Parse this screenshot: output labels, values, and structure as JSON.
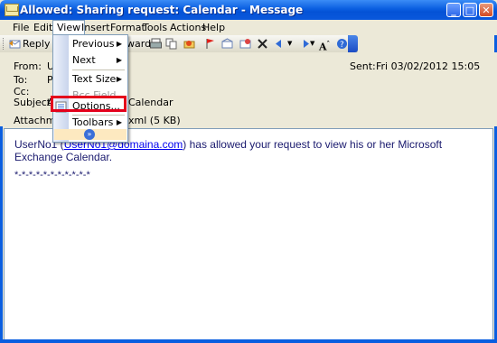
{
  "window": {
    "title": "Allowed: Sharing request: Calendar - Message",
    "minimize": "_",
    "maximize": "□",
    "close": "✕"
  },
  "menubar": {
    "items": [
      "File",
      "Edit",
      "View",
      "Insert",
      "Format",
      "Tools",
      "Actions",
      "Help"
    ]
  },
  "toolbar": {
    "reply": "Reply",
    "forward": "Forward",
    "forward_partial": "ward"
  },
  "header": {
    "from_label": "From:",
    "from_value": "U",
    "to_label": "To:",
    "to_value": "P",
    "cc_label": "Cc:",
    "subject_label": "Subject:",
    "subject_value": "A",
    "subject_tail": "Calendar",
    "attachments_label": "Attachments:",
    "attachment_tail": "xml (5 KB)",
    "sent_label": "Sent:",
    "sent_value": "Fri 03/02/2012 15:05"
  },
  "body": {
    "prefix": "UserNo1 (",
    "email": "UserNo1@domaina.com",
    "suffix": ") has allowed your request to view his or her Microsoft Exchange Calendar.",
    "signature": "*-*-*-*-*-*-*-*-*-*-*"
  },
  "view_menu": {
    "items": [
      {
        "label": "Previous",
        "submenu": true
      },
      {
        "label": "Next",
        "submenu": true
      },
      {
        "label": "Text Size",
        "submenu": true
      },
      {
        "label": "Bcc Field",
        "disabled": true
      },
      {
        "label": "Options...",
        "highlighted": true
      },
      {
        "label": "Toolbars",
        "submenu": true
      }
    ],
    "expand": "»"
  },
  "colors": {
    "titlebar": "#0a5ee0",
    "highlight_border": "#e4001b",
    "link": "#0000ee"
  }
}
